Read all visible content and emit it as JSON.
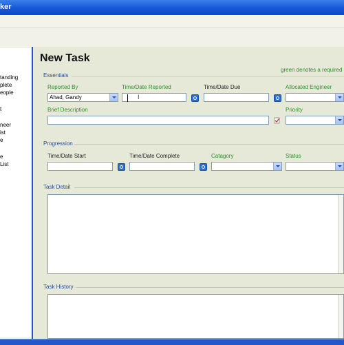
{
  "window": {
    "title_fragment": "ker"
  },
  "sidebar": {
    "items": [
      "tanding",
      "plete",
      "eople",
      "t",
      "neer",
      "ist",
      "e",
      "e",
      "List"
    ]
  },
  "form": {
    "title": "New Task",
    "hint": "green denotes a required f",
    "essentials": {
      "heading": "Essentials",
      "reported_by": {
        "label": "Reported By",
        "value": "Ahad, Gandy"
      },
      "time_reported": {
        "label": "Time/Date Reported",
        "value": ""
      },
      "time_due": {
        "label": "Time/Date Due",
        "value": ""
      },
      "engineer": {
        "label": "Allocated Engineer",
        "value": ""
      },
      "description": {
        "label": "Brief Description",
        "value": ""
      },
      "priority": {
        "label": "Priority",
        "value": ""
      }
    },
    "progression": {
      "heading": "Progression",
      "date_start": {
        "label": "Time/Date Start",
        "value": ""
      },
      "date_complete": {
        "label": "Time/Date Complete",
        "value": ""
      },
      "category": {
        "label": "Catagory",
        "value": ""
      },
      "status": {
        "label": "Status",
        "value": ""
      }
    },
    "task_detail": {
      "heading": "Task Detail"
    },
    "task_history": {
      "heading": "Task History"
    }
  },
  "colors": {
    "required": "#2e8b2e",
    "section": "#2a4d8f",
    "titlebar": "#1657d8",
    "panel": "#e7e9d8"
  },
  "icons": [
    "calendar-icon",
    "spellcheck-icon",
    "dropdown-arrow-icon",
    "text-cursor-icon"
  ]
}
